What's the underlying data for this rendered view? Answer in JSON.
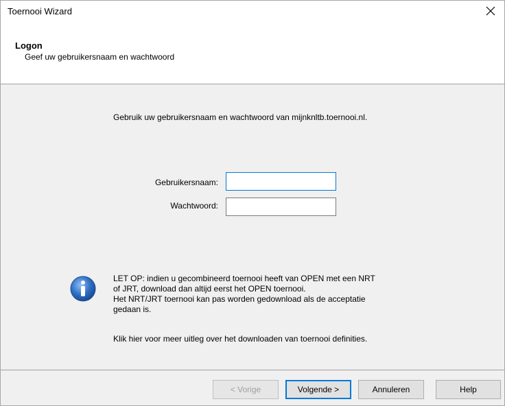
{
  "window": {
    "title": "Toernooi Wizard",
    "close_icon": "close-icon"
  },
  "header": {
    "title": "Logon",
    "subtitle": "Geef uw gebruikersnaam en wachtwoord"
  },
  "main": {
    "intro": "Gebruik uw gebruikersnaam en wachtwoord van mijnknltb.toernooi.nl.",
    "username_label": "Gebruikersnaam:",
    "username_value": "",
    "password_label": "Wachtwoord:",
    "password_value": "",
    "info_icon": "info-icon",
    "notice_line1": "LET OP: indien u gecombineerd toernooi heeft van OPEN met een NRT",
    "notice_line2": "of JRT, download dan altijd eerst het OPEN toernooi.",
    "notice_line3": "Het NRT/JRT toernooi kan pas worden gedownload als de acceptatie",
    "notice_line4": "gedaan is.",
    "help_link": "Klik hier voor meer uitleg over het downloaden van toernooi definities."
  },
  "footer": {
    "prev_label": "< Vorige",
    "next_label": "Volgende >",
    "cancel_label": "Annuleren",
    "help_label": "Help"
  },
  "colors": {
    "accent": "#0078d7",
    "info_icon_fill": "#2f6fc4"
  }
}
